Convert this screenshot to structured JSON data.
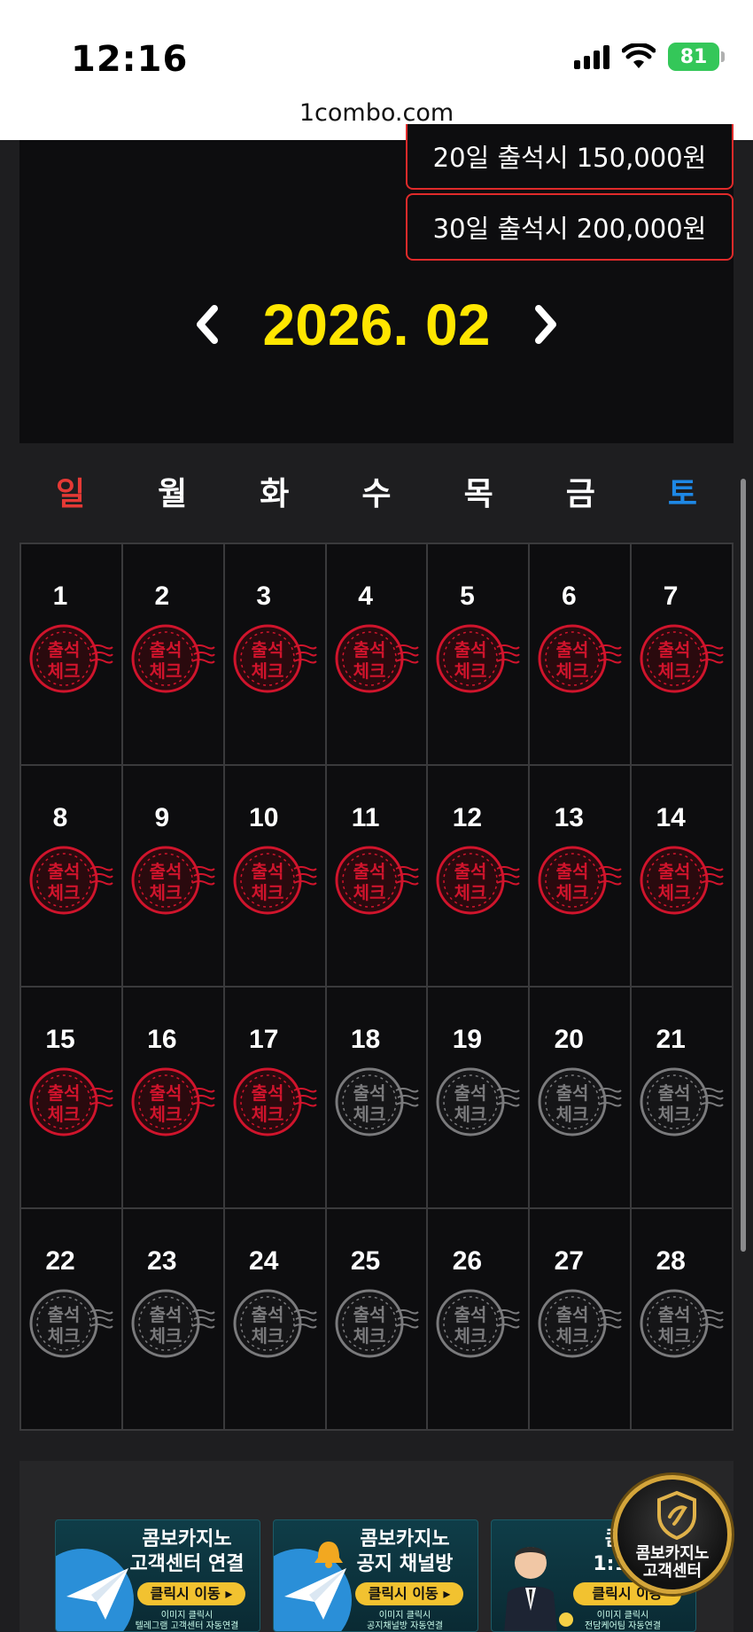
{
  "status_bar": {
    "time": "12:16",
    "battery": "81"
  },
  "browser": {
    "url": "1combo.com"
  },
  "rewards": [
    {
      "label": "20일 출석시 150,000원"
    },
    {
      "label": "30일 출석시 200,000원"
    }
  ],
  "calendar": {
    "month": "2026. 02",
    "weekdays": [
      "일",
      "월",
      "화",
      "수",
      "목",
      "금",
      "토"
    ],
    "stamp_text_top": "출석",
    "stamp_text_bottom": "체크",
    "checked_through_day": 17,
    "days": [
      "1",
      "2",
      "3",
      "4",
      "5",
      "6",
      "7",
      "8",
      "9",
      "10",
      "11",
      "12",
      "13",
      "14",
      "15",
      "16",
      "17",
      "18",
      "19",
      "20",
      "21",
      "22",
      "23",
      "24",
      "25",
      "26",
      "27",
      "28"
    ]
  },
  "banners": [
    {
      "title_line1": "콤보카지노",
      "title_line2": "고객센터 연결",
      "button": "클릭시 이동 ▸",
      "foot_line1": "이미지 클릭시",
      "foot_line2": "텔레그램 고객센터 자동연결"
    },
    {
      "title_line1": "콤보카지노",
      "title_line2": "공지 채널방",
      "button": "클릭시 이동 ▸",
      "foot_line1": "이미지 클릭시",
      "foot_line2": "공지채널방 자동연결"
    },
    {
      "title_line1": "콤보",
      "title_line2": "1:1 전",
      "button": "클릭시 이동",
      "foot_line1": "이미지 클릭시",
      "foot_line2": "전담케어팀 자동연결"
    }
  ],
  "cs_badge": {
    "label_line1": "콤보카지노",
    "label_line2": "고객센터"
  },
  "colors": {
    "month": "#ffe600",
    "sunday": "#e53935",
    "saturday": "#1e88e5",
    "stamp_active": "#d0142c",
    "stamp_inactive": "#7a7a7c",
    "reward_border": "#e02a2a"
  }
}
